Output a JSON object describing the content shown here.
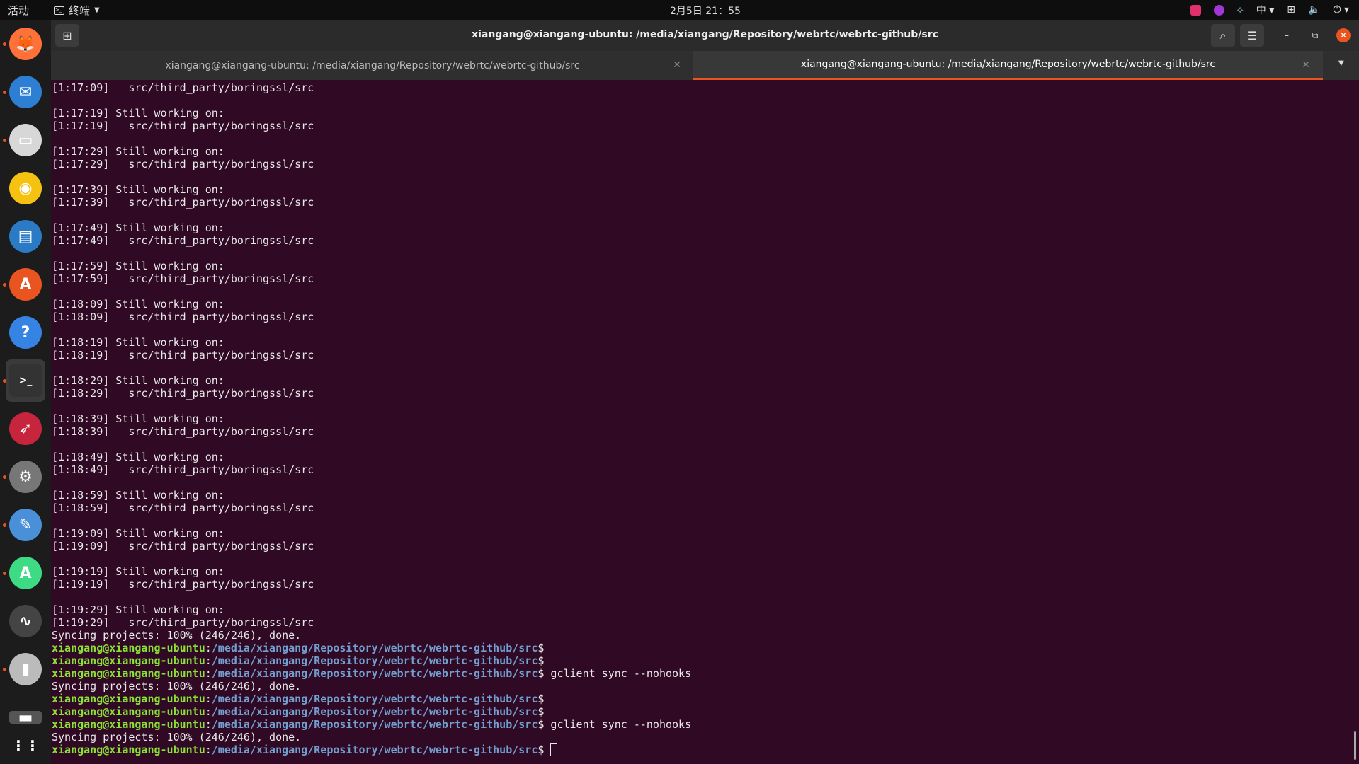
{
  "topbar": {
    "activities": "活动",
    "app_name": "终端",
    "clock": "2月5日  21：55",
    "input_method": "中"
  },
  "dock": {
    "items": [
      {
        "name": "firefox-icon",
        "color": "#ff7139"
      },
      {
        "name": "thunderbird-icon",
        "color": "#2d7fd3"
      },
      {
        "name": "files-icon",
        "color": "#d7d7d7"
      },
      {
        "name": "rhythmbox-icon",
        "color": "#f5c211"
      },
      {
        "name": "libreoffice-writer-icon",
        "color": "#2a7ac6"
      },
      {
        "name": "software-icon",
        "color": "#e95420"
      },
      {
        "name": "help-icon",
        "color": "#3584e4"
      },
      {
        "name": "terminal-icon",
        "color": "#333333"
      },
      {
        "name": "remmina-icon",
        "color": "#c7253e"
      },
      {
        "name": "settings-icon",
        "color": "#777777"
      },
      {
        "name": "text-editor-icon",
        "color": "#4a90d9"
      },
      {
        "name": "android-studio-icon",
        "color": "#3ddc84"
      },
      {
        "name": "system-monitor-icon",
        "color": "#444444"
      },
      {
        "name": "archive-icon",
        "color": "#bbbbbb"
      },
      {
        "name": "drive-icon",
        "color": "#555555"
      },
      {
        "name": "show-apps-icon",
        "color": "#ffffff"
      }
    ]
  },
  "window": {
    "title": "xiangang@xiangang-ubuntu: /media/xiangang/Repository/webrtc/webrtc-github/src",
    "tabs": [
      {
        "label": "xiangang@xiangang-ubuntu: /media/xiangang/Repository/webrtc/webrtc-github/src",
        "active": false
      },
      {
        "label": "xiangang@xiangang-ubuntu: /media/xiangang/Repository/webrtc/webrtc-github/src",
        "active": true
      }
    ]
  },
  "terminal": {
    "prompt_user": "xiangang@xiangang-ubuntu",
    "prompt_path": "/media/xiangang/Repository/webrtc/webrtc-github/src",
    "lines": [
      {
        "t": "out",
        "text": "[1:17:09]   src/third_party/boringssl/src"
      },
      {
        "t": "out",
        "text": ""
      },
      {
        "t": "out",
        "text": "[1:17:19] Still working on:"
      },
      {
        "t": "out",
        "text": "[1:17:19]   src/third_party/boringssl/src"
      },
      {
        "t": "out",
        "text": ""
      },
      {
        "t": "out",
        "text": "[1:17:29] Still working on:"
      },
      {
        "t": "out",
        "text": "[1:17:29]   src/third_party/boringssl/src"
      },
      {
        "t": "out",
        "text": ""
      },
      {
        "t": "out",
        "text": "[1:17:39] Still working on:"
      },
      {
        "t": "out",
        "text": "[1:17:39]   src/third_party/boringssl/src"
      },
      {
        "t": "out",
        "text": ""
      },
      {
        "t": "out",
        "text": "[1:17:49] Still working on:"
      },
      {
        "t": "out",
        "text": "[1:17:49]   src/third_party/boringssl/src"
      },
      {
        "t": "out",
        "text": ""
      },
      {
        "t": "out",
        "text": "[1:17:59] Still working on:"
      },
      {
        "t": "out",
        "text": "[1:17:59]   src/third_party/boringssl/src"
      },
      {
        "t": "out",
        "text": ""
      },
      {
        "t": "out",
        "text": "[1:18:09] Still working on:"
      },
      {
        "t": "out",
        "text": "[1:18:09]   src/third_party/boringssl/src"
      },
      {
        "t": "out",
        "text": ""
      },
      {
        "t": "out",
        "text": "[1:18:19] Still working on:"
      },
      {
        "t": "out",
        "text": "[1:18:19]   src/third_party/boringssl/src"
      },
      {
        "t": "out",
        "text": ""
      },
      {
        "t": "out",
        "text": "[1:18:29] Still working on:"
      },
      {
        "t": "out",
        "text": "[1:18:29]   src/third_party/boringssl/src"
      },
      {
        "t": "out",
        "text": ""
      },
      {
        "t": "out",
        "text": "[1:18:39] Still working on:"
      },
      {
        "t": "out",
        "text": "[1:18:39]   src/third_party/boringssl/src"
      },
      {
        "t": "out",
        "text": ""
      },
      {
        "t": "out",
        "text": "[1:18:49] Still working on:"
      },
      {
        "t": "out",
        "text": "[1:18:49]   src/third_party/boringssl/src"
      },
      {
        "t": "out",
        "text": ""
      },
      {
        "t": "out",
        "text": "[1:18:59] Still working on:"
      },
      {
        "t": "out",
        "text": "[1:18:59]   src/third_party/boringssl/src"
      },
      {
        "t": "out",
        "text": ""
      },
      {
        "t": "out",
        "text": "[1:19:09] Still working on:"
      },
      {
        "t": "out",
        "text": "[1:19:09]   src/third_party/boringssl/src"
      },
      {
        "t": "out",
        "text": ""
      },
      {
        "t": "out",
        "text": "[1:19:19] Still working on:"
      },
      {
        "t": "out",
        "text": "[1:19:19]   src/third_party/boringssl/src"
      },
      {
        "t": "out",
        "text": ""
      },
      {
        "t": "out",
        "text": "[1:19:29] Still working on:"
      },
      {
        "t": "out",
        "text": "[1:19:29]   src/third_party/boringssl/src"
      },
      {
        "t": "out",
        "text": "Syncing projects: 100% (246/246), done."
      },
      {
        "t": "prompt",
        "cmd": ""
      },
      {
        "t": "prompt",
        "cmd": ""
      },
      {
        "t": "prompt",
        "cmd": " gclient sync --nohooks"
      },
      {
        "t": "out",
        "text": "Syncing projects: 100% (246/246), done."
      },
      {
        "t": "prompt",
        "cmd": ""
      },
      {
        "t": "prompt",
        "cmd": ""
      },
      {
        "t": "prompt",
        "cmd": " gclient sync --nohooks"
      },
      {
        "t": "out",
        "text": "Syncing projects: 100% (246/246), done."
      },
      {
        "t": "prompt",
        "cmd": " ",
        "cursor": true
      }
    ]
  }
}
